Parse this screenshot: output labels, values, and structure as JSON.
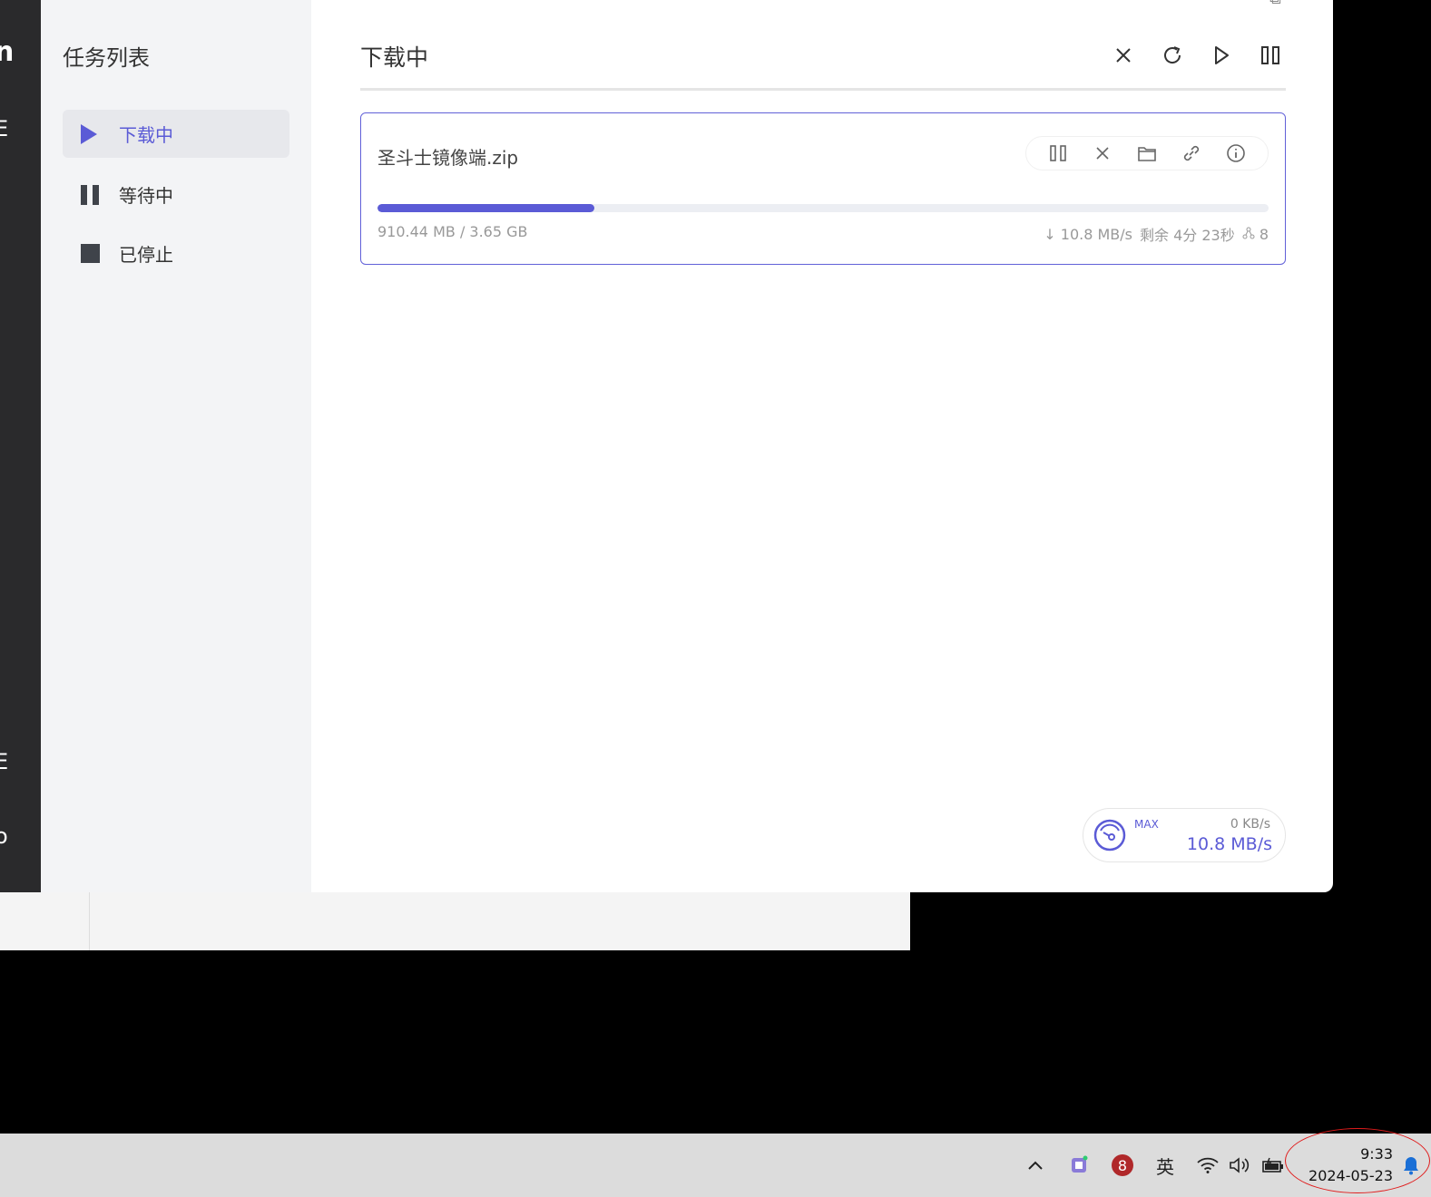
{
  "sidebar": {
    "title": "任务列表",
    "items": [
      {
        "label": "下载中",
        "icon": "play-icon",
        "active": true
      },
      {
        "label": "等待中",
        "icon": "pause-icon",
        "active": false
      },
      {
        "label": "已停止",
        "icon": "stop-icon",
        "active": false
      }
    ]
  },
  "main": {
    "title": "下载中",
    "actions": [
      "close-icon",
      "refresh-icon",
      "play-icon",
      "pause-icon"
    ]
  },
  "task": {
    "name": "圣斗士镜像端.zip",
    "progress_fraction": 0.243,
    "size_text": "910.44 MB / 3.65 GB",
    "speed_text": "↓ 10.8 MB/s",
    "remaining_text": "剩余 4分 23秒",
    "connections_text": "8",
    "actions": [
      "pause-icon",
      "close-icon",
      "folder-icon",
      "link-icon",
      "info-icon"
    ]
  },
  "speed_widget": {
    "max_label": "MAX",
    "upload": "0 KB/s",
    "download": "10.8 MB/s"
  },
  "taskbar": {
    "ime": "英",
    "time": "9:33",
    "date": "2024-05-23"
  },
  "colors": {
    "accent": "#5b5bd6",
    "sidebar_bg": "#f3f4f6",
    "annotation": "#e01b1b"
  }
}
